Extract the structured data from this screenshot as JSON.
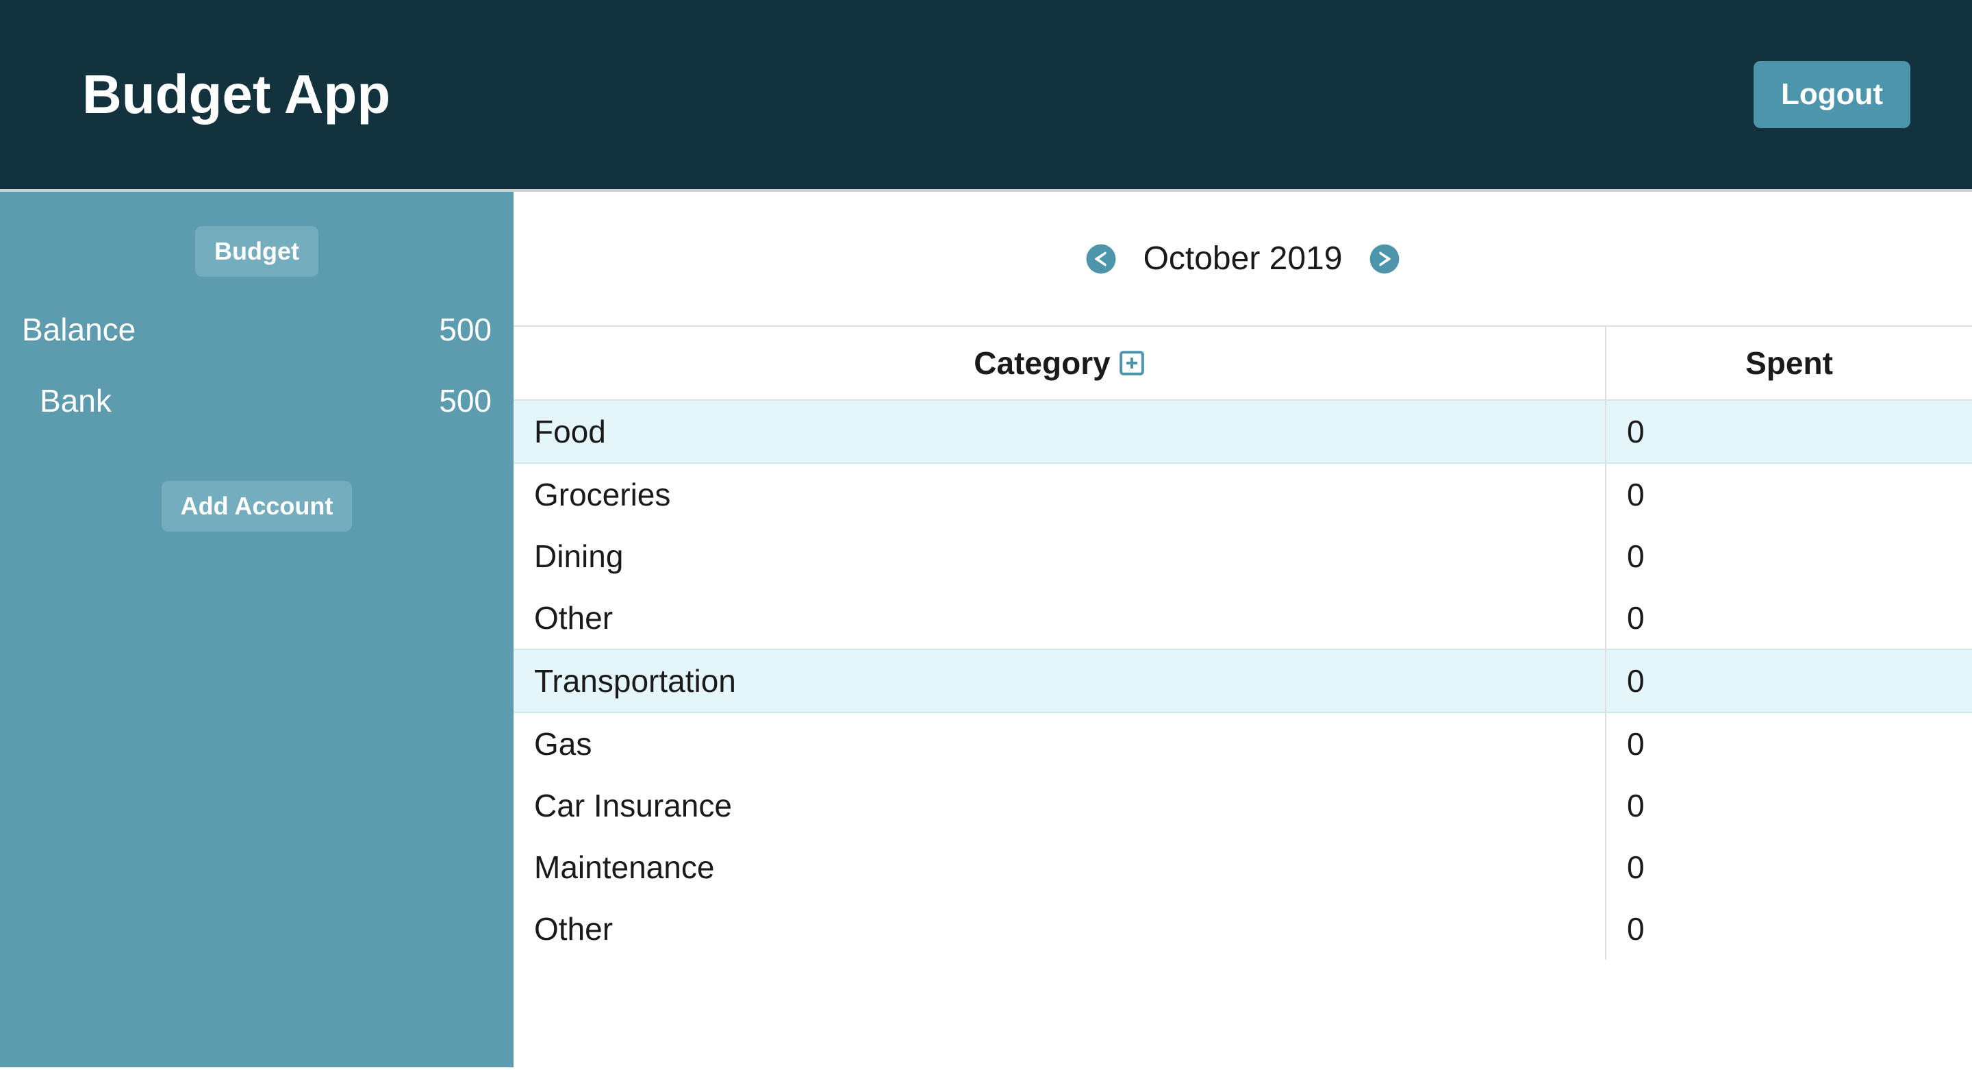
{
  "header": {
    "title": "Budget App",
    "logout_label": "Logout"
  },
  "sidebar": {
    "budget_label": "Budget",
    "balance_label": "Balance",
    "balance_value": "500",
    "accounts": [
      {
        "name": "Bank",
        "value": "500"
      }
    ],
    "add_account_label": "Add Account"
  },
  "main": {
    "month_label": "October 2019",
    "table": {
      "headers": {
        "category": "Category",
        "spent": "Spent"
      },
      "rows": [
        {
          "category": "Food",
          "spent": "0",
          "group": true
        },
        {
          "category": "Groceries",
          "spent": "0",
          "group": false
        },
        {
          "category": "Dining",
          "spent": "0",
          "group": false
        },
        {
          "category": "Other",
          "spent": "0",
          "group": false
        },
        {
          "category": "Transportation",
          "spent": "0",
          "group": true
        },
        {
          "category": "Gas",
          "spent": "0",
          "group": false
        },
        {
          "category": "Car Insurance",
          "spent": "0",
          "group": false
        },
        {
          "category": "Maintenance",
          "spent": "0",
          "group": false
        },
        {
          "category": "Other",
          "spent": "0",
          "group": false
        }
      ]
    }
  }
}
